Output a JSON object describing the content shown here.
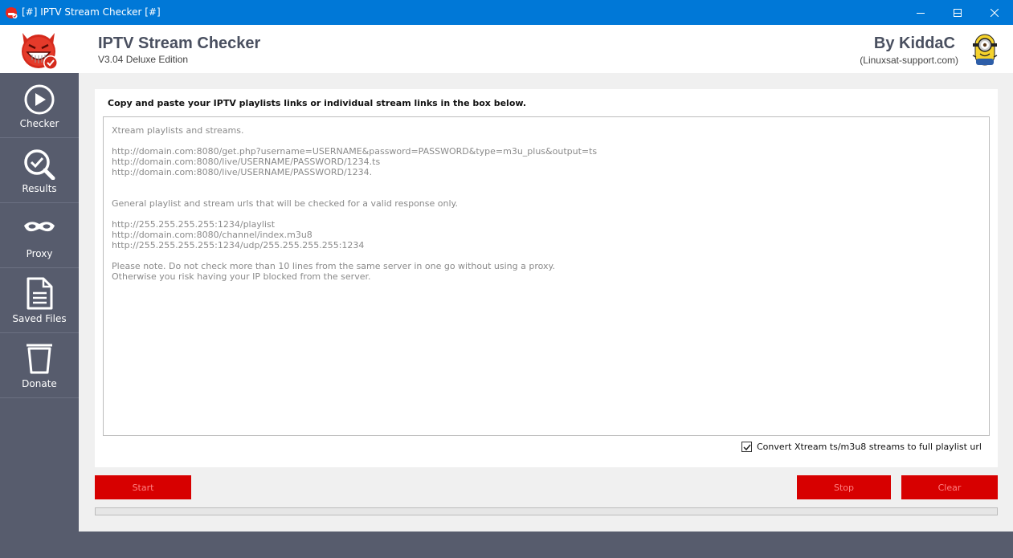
{
  "window": {
    "title": "[#] IPTV Stream Checker [#]"
  },
  "header": {
    "app_name": "IPTV Stream Checker",
    "version": "V3.04 Deluxe Edition",
    "by_line": "By KiddaC",
    "site": "(Linuxsat-support.com)"
  },
  "sidebar": {
    "items": [
      {
        "label": "Checker",
        "icon": "play-circle-icon"
      },
      {
        "label": "Results",
        "icon": "magnifier-check-icon"
      },
      {
        "label": "Proxy",
        "icon": "mask-icon"
      },
      {
        "label": "Saved Files",
        "icon": "document-icon"
      },
      {
        "label": "Donate",
        "icon": "cup-icon"
      }
    ]
  },
  "main": {
    "instructions": "Copy and paste your IPTV playlists links or individual stream links in the box below.",
    "input_value": "",
    "placeholder_lines": [
      "Xtream playlists and streams.",
      "",
      "http://domain.com:8080/get.php?username=USERNAME&password=PASSWORD&type=m3u_plus&output=ts",
      "http://domain.com:8080/live/USERNAME/PASSWORD/1234.ts",
      "http://domain.com:8080/live/USERNAME/PASSWORD/1234.",
      "",
      "",
      "General playlist and stream urls that will be checked for a valid response only.",
      "",
      "http://255.255.255.255:1234/playlist",
      "http://domain.com:8080/channel/index.m3u8",
      "http://255.255.255.255:1234/udp/255.255.255.255:1234",
      "",
      "Please note. Do not check more than 10 lines from the same server in one go without using a proxy.",
      "Otherwise you risk having your IP blocked from the server."
    ],
    "convert_checkbox": {
      "label": "Convert Xtream ts/m3u8 streams to full playlist url",
      "checked": true
    },
    "buttons": {
      "start": "Start",
      "stop": "Stop",
      "clear": "Clear"
    },
    "progress": 0
  },
  "colors": {
    "titlebar": "#0078d7",
    "sidebar": "#575c6d",
    "button": "#d70000",
    "button_text": "#ff8080"
  }
}
